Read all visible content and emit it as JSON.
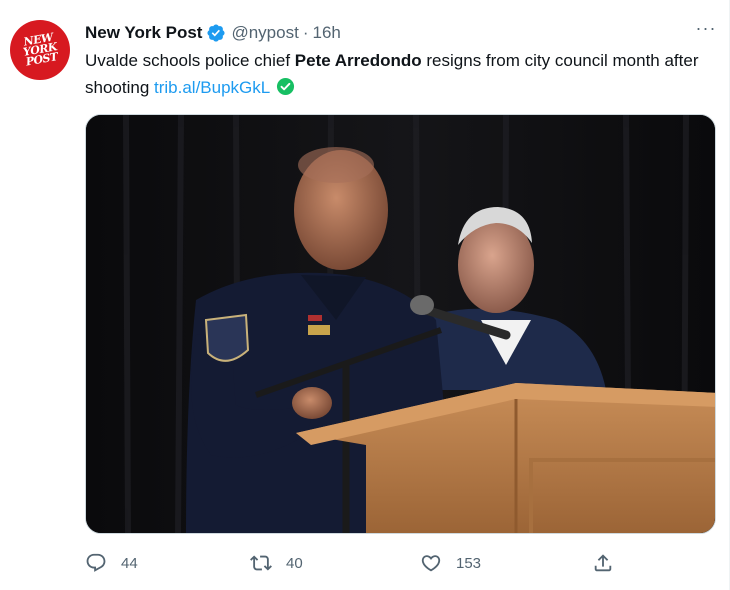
{
  "tweet": {
    "author_name": "New York Post",
    "handle": "@nypost",
    "separator": "·",
    "time": "16h",
    "avatar_logo": [
      "NEW",
      "YORK",
      "POST"
    ],
    "text_parts": {
      "prefix": "Uvalde schools police chief ",
      "bold": "Pete Arredondo",
      "suffix": " resigns from city council month after shooting ",
      "link": "trib.al/BupkGkL"
    },
    "more_label": "···",
    "media_image": "photo",
    "actions": {
      "replies": "44",
      "retweets": "40",
      "likes": "153"
    },
    "colors": {
      "accent": "#1d9bf0",
      "verified_check_green": "#17bf63",
      "muted_text": "#536471",
      "logo_red": "#d71920"
    },
    "icons": [
      "verified-badge-icon",
      "more-icon",
      "link-check-icon",
      "reply-icon",
      "retweet-icon",
      "like-icon",
      "share-icon"
    ]
  }
}
